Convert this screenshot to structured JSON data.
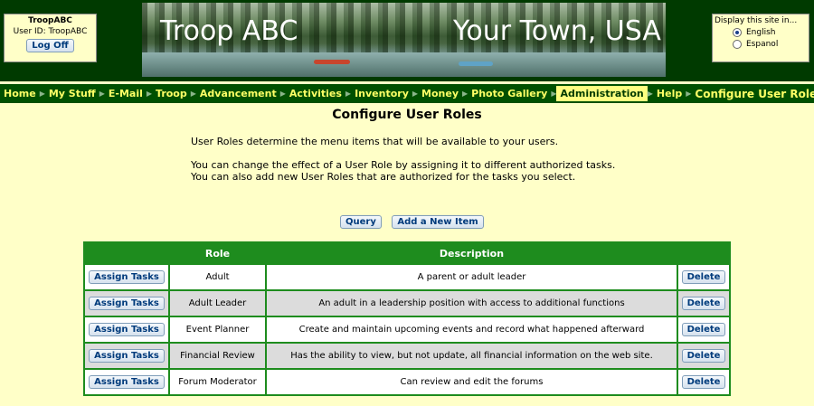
{
  "user_panel": {
    "org": "TroopABC",
    "user_id": "User ID:  TroopABC",
    "logoff_label": "Log Off"
  },
  "banner": {
    "left_text": "Troop ABC",
    "right_text": "Your Town, USA"
  },
  "language": {
    "title": "Display this site in...",
    "options": [
      "English",
      "Espanol"
    ],
    "selected": "English"
  },
  "nav": {
    "items": [
      "Home",
      "My Stuff",
      "E-Mail",
      "Troop",
      "Advancement",
      "Activities",
      "Inventory",
      "Money",
      "Photo Gallery",
      "Administration",
      "Help"
    ],
    "active": "Administration",
    "current_page": "Configure User Roles"
  },
  "page": {
    "title": "Configure User Roles",
    "intro1": "User Roles determine the menu items that will be available to your users.",
    "intro2": "You can change the effect of a User Role by assigning it to different authorized tasks.   You can also add new User Roles that are authorized for the tasks you select.",
    "query_label": "Query",
    "add_label": "Add a New Item"
  },
  "table": {
    "headers": [
      "",
      "Role",
      "Description",
      ""
    ],
    "assign_label": "Assign Tasks",
    "delete_label": "Delete",
    "rows": [
      {
        "role": "Adult",
        "description": "A parent or adult leader"
      },
      {
        "role": "Adult Leader",
        "description": "An adult in a leadership position with access to additional functions"
      },
      {
        "role": "Event Planner",
        "description": "Create and maintain upcoming events and record what happened afterward"
      },
      {
        "role": "Financial Review",
        "description": "Has the ability to view, but not update, all financial information on the web site."
      },
      {
        "role": "Forum Moderator",
        "description": "Can review and edit the forums"
      }
    ]
  },
  "colors": {
    "header_bg": "#003a00",
    "nav_bg": "#005000",
    "nav_text": "#ffff66",
    "page_bg": "#ffffc8",
    "table_green": "#1e8c1e"
  }
}
